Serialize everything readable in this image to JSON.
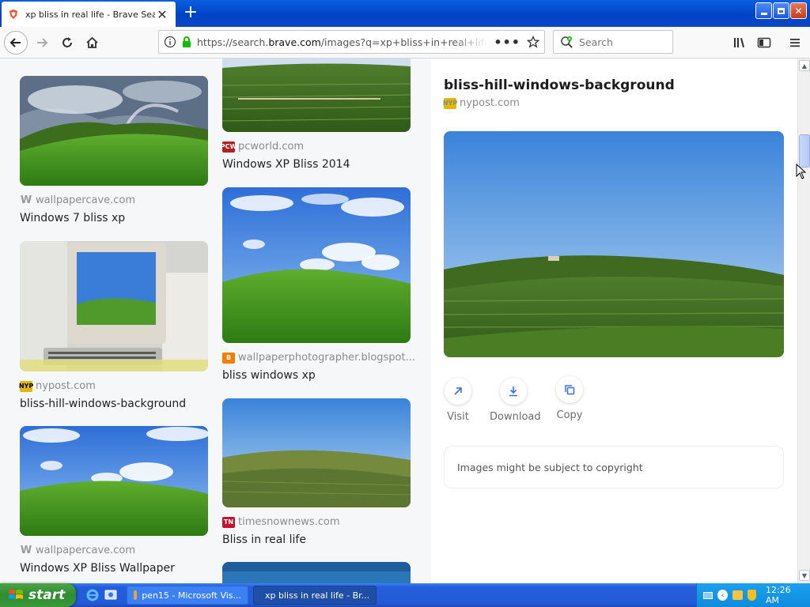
{
  "browser": {
    "tab_title": "xp bliss in real life - Brave Search",
    "url_prefix": "https://search.",
    "url_domain": "brave.com",
    "url_rest": "/images?q=xp+bliss+in+real+life&s",
    "search_placeholder": "Search"
  },
  "results": [
    {
      "source": "pcworld.com",
      "caption": "Windows XP Bliss 2014",
      "icon": "PCW",
      "icon_color": "#b22222"
    },
    {
      "source": "wallpapercave.com",
      "caption": "Windows 7 bliss xp",
      "icon": "W",
      "icon_color": "#9a9a9a"
    },
    {
      "source": "nypost.com",
      "caption": "bliss-hill-windows-background",
      "icon": "NYP",
      "icon_color": "#e0b800"
    },
    {
      "source": "wallpaperphotographer.blogspot...",
      "caption": "bliss windows xp",
      "icon": "B",
      "icon_color": "#f57d00"
    },
    {
      "source": "wallpapercave.com",
      "caption": "Windows XP Bliss Wallpaper",
      "icon": "W",
      "icon_color": "#9a9a9a"
    },
    {
      "source": "timesnownews.com",
      "caption": "Bliss in real life",
      "icon": "TN",
      "icon_color": "#c41230"
    }
  ],
  "detail": {
    "title": "bliss-hill-windows-background",
    "source": "nypost.com",
    "actions": {
      "visit": "Visit",
      "download": "Download",
      "copy": "Copy"
    },
    "notice": "Images might be subject to copyright"
  },
  "taskbar": {
    "start": "start",
    "tasks": [
      "pen15 - Microsoft Vis...",
      "xp bliss in real life - Br..."
    ],
    "clock": "12:26 AM"
  },
  "colors": {
    "titlebar": "#0043c8",
    "taskbar": "#245edb",
    "start": "#2f8b2f"
  }
}
